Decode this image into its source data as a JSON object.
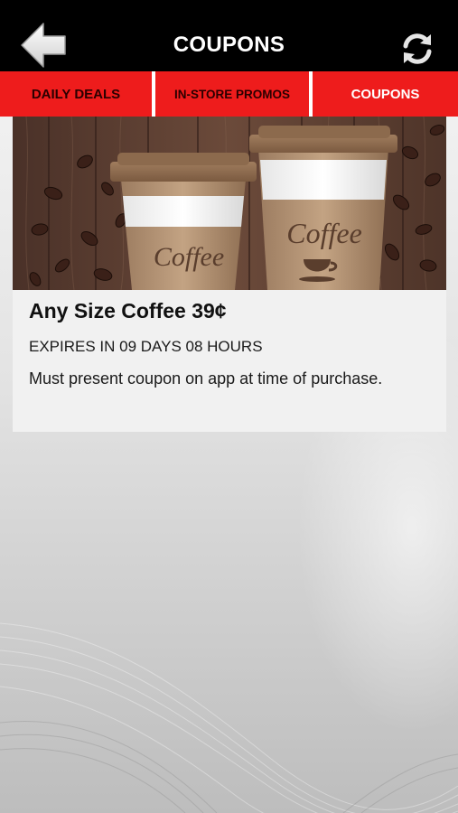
{
  "header": {
    "title": "COUPONS",
    "back_icon": "back-arrow-icon",
    "refresh_icon": "refresh-icon"
  },
  "tabs": [
    {
      "label": "DAILY DEALS",
      "active": false
    },
    {
      "label": "IN-STORE PROMOS",
      "active": false
    },
    {
      "label": "COUPONS",
      "active": true
    }
  ],
  "coupon": {
    "image_alt_text": "Coffee",
    "title": "Any Size Coffee 39¢",
    "expiry": "EXPIRES IN 09 DAYS 08 HOURS",
    "description": "Must present coupon on app at time of purchase."
  },
  "colors": {
    "header_bg": "#000000",
    "tab_bg": "#ee1c1c",
    "tab_text_inactive": "#2b0000",
    "tab_text_active": "#ffffff",
    "card_bg": "#f1f1f1"
  }
}
